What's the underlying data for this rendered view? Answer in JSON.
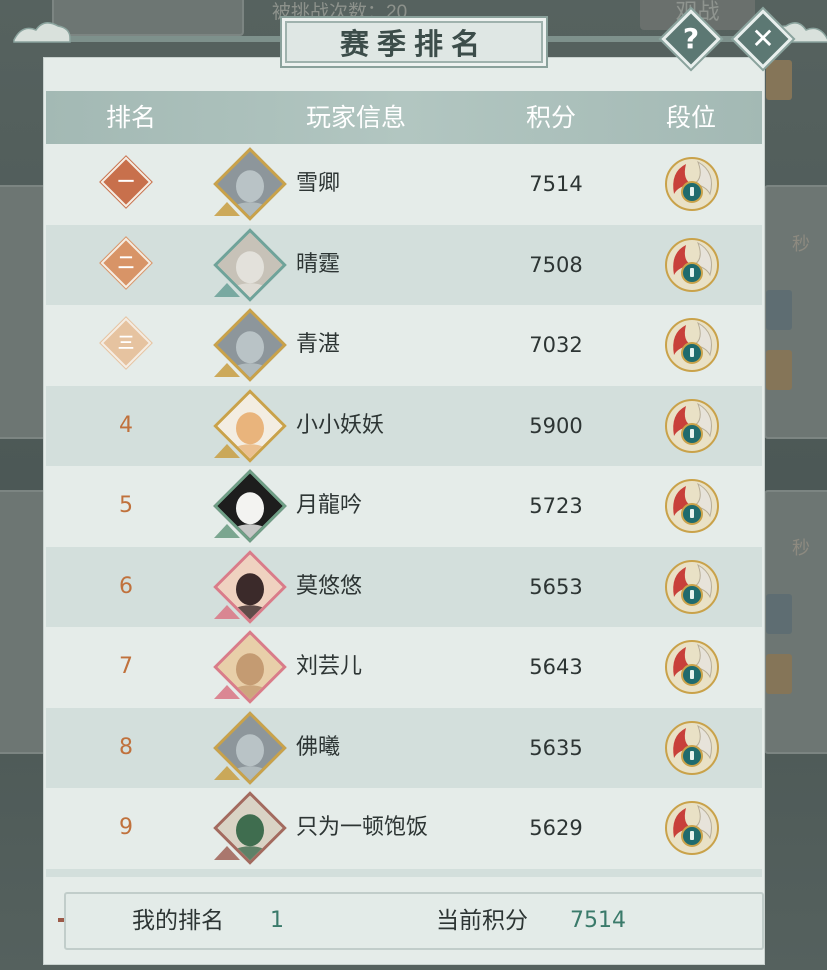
{
  "background": {
    "top_text": "被挑战次数：20",
    "watch_button": "观战",
    "side_text_1": "秒",
    "side_text_2": "秒"
  },
  "title": "赛季排名",
  "buttons": {
    "help": "?",
    "close": "✕"
  },
  "columns": {
    "rank": "排名",
    "player": "玩家信息",
    "score": "积分",
    "tier": "段位"
  },
  "rows": [
    {
      "rank": "一",
      "medal": true,
      "name": "雪卿",
      "score": "7514",
      "avatar": "silver-hair-man-gold-frame-icon"
    },
    {
      "rank": "二",
      "medal": true,
      "name": "晴霆",
      "score": "7508",
      "avatar": "white-hair-man-teal-frame-icon"
    },
    {
      "rank": "三",
      "medal": true,
      "name": "青湛",
      "score": "7032",
      "avatar": "silver-hair-man-gold-frame-icon"
    },
    {
      "rank": "4",
      "medal": false,
      "name": "小小妖妖",
      "score": "5900",
      "avatar": "cat-gold-frame-icon"
    },
    {
      "rank": "5",
      "medal": false,
      "name": "月龍吟",
      "score": "5723",
      "avatar": "panda-green-frame-icon"
    },
    {
      "rank": "6",
      "medal": false,
      "name": "莫悠悠",
      "score": "5653",
      "avatar": "lady-blossom-frame-icon"
    },
    {
      "rank": "7",
      "medal": false,
      "name": "刘芸儿",
      "score": "5643",
      "avatar": "rabbit-blossom-frame-icon"
    },
    {
      "rank": "8",
      "medal": false,
      "name": "佛曦",
      "score": "5635",
      "avatar": "silver-hair-man-gold-frame-icon"
    },
    {
      "rank": "9",
      "medal": false,
      "name": "只为一顿饱饭",
      "score": "5629",
      "avatar": "duck-blossom-frame-icon"
    }
  ],
  "tier_icon": "dragon-orb-tier-icon",
  "footer": {
    "my_rank_label": "我的排名",
    "my_rank": "1",
    "score_label": "当前积分",
    "score": "7514"
  },
  "colors": {
    "panel": "#e5ece9",
    "row_alt": "#d3dfdc",
    "header": "#a8bdb8",
    "rank_text": "#c0713c",
    "footer_value": "#3a7a6a"
  }
}
